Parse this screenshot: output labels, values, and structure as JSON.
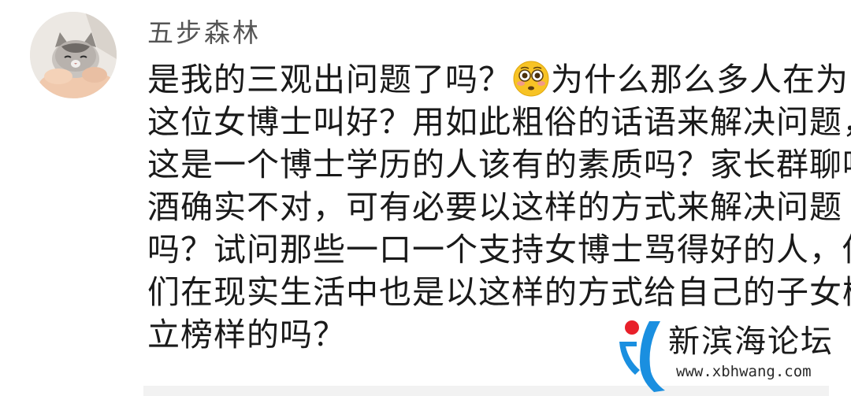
{
  "comment": {
    "author": {
      "name": "五步森林",
      "avatar": "cat-photo-avatar"
    },
    "text_lines": [
      {
        "before": "是我的三观出问题了吗？",
        "emoji": "flushed-face-icon",
        "after": "为什么那么多人在为"
      },
      {
        "text": "这位女博士叫好？用如此粗俗的话语来解决问题，"
      },
      {
        "text": "这是一个博士学历的人该有的素质吗？家长群聊喝"
      },
      {
        "text": "酒确实不对，可有必要以这样的方式来解决问题"
      },
      {
        "text": "吗？试问那些一口一个支持女博士骂得好的人，你"
      },
      {
        "text": "们在现实生活中也是以这样的方式给自己的子女树"
      },
      {
        "text": "立榜样的吗？"
      }
    ]
  },
  "watermark": {
    "title": "新滨海论坛",
    "url": "www.xbhwang.com",
    "colors": {
      "blue": "#1a8fe0",
      "red": "#e8202a"
    }
  }
}
